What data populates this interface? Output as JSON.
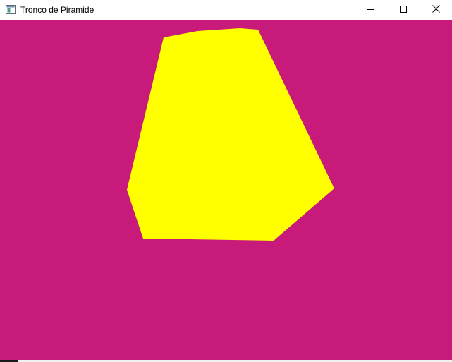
{
  "window": {
    "title": "Tronco de Piramide",
    "controls": {
      "minimize_icon": "minimize-icon",
      "maximize_icon": "maximize-icon",
      "close_icon": "close-icon"
    }
  },
  "scene": {
    "background_color": "#c81a7b",
    "shape_color": "#ffff00",
    "shape": "yellow polygon (truncated pyramid projection)"
  }
}
